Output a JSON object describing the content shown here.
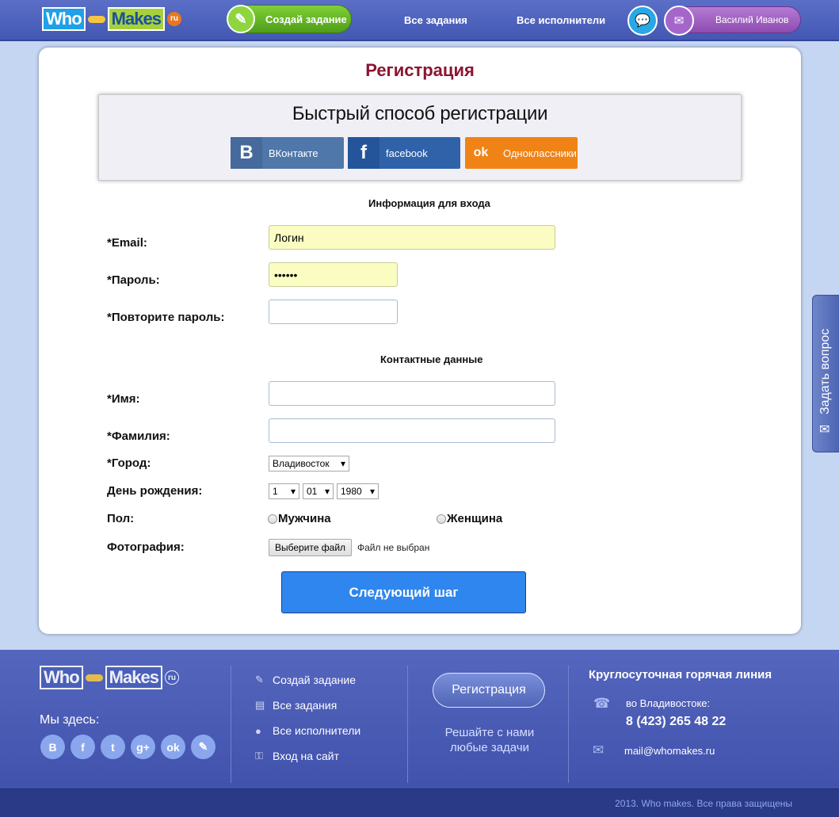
{
  "header": {
    "logo_who": "Who",
    "logo_makes": "Makes",
    "logo_ru": "ru",
    "create_task": "Создай задание",
    "all_tasks": "Все задания",
    "all_performers": "Все исполнители",
    "user_name": "Василий Иванов"
  },
  "page": {
    "title": "Регистрация",
    "quick_title": "Быстрый способ регистрации",
    "social": [
      {
        "label": "ВКонтакте",
        "glyph": "B",
        "color": "#4f77a9",
        "icon": "vk-icon"
      },
      {
        "label": "facebook",
        "glyph": "f",
        "color": "#2f62a8",
        "icon": "facebook-icon"
      },
      {
        "label": "Одноклассники",
        "glyph": "ok",
        "color": "#f08316",
        "icon": "odnoklassniki-icon"
      }
    ],
    "login_section": "Информация для входа",
    "contact_section": "Контактные данные"
  },
  "form": {
    "email_label": "*Email:",
    "email_value": "Логин",
    "password_label": "*Пароль:",
    "password_value": "••••••",
    "password2_label": "*Повторите пароль:",
    "first_name_label": "*Имя:",
    "last_name_label": "*Фамилия:",
    "city_label": "*Город:",
    "city_value": "Владивосток",
    "birthday_label": "День рождения:",
    "birth_day": "1",
    "birth_month": "01",
    "birth_year": "1980",
    "gender_label": "Пол:",
    "gender_male": "Мужчина",
    "gender_female": "Женщина",
    "photo_label": "Фотография:",
    "file_button": "Выберите файл",
    "file_status": "Файл не выбран",
    "next_button": "Следующий шаг"
  },
  "side_tab": {
    "label": "Задать вопрос"
  },
  "footer": {
    "here_label": "Мы здесь:",
    "social_icons": [
      "B",
      "f",
      "t",
      "g+",
      "ok",
      "✎"
    ],
    "links": [
      {
        "label": "Создай задание",
        "icon": "✎"
      },
      {
        "label": "Все задания",
        "icon": "▤"
      },
      {
        "label": "Все исполнители",
        "icon": "●"
      },
      {
        "label": "Вход на сайт",
        "icon": "⚿"
      }
    ],
    "register_button": "Регистрация",
    "slogan": "Решайте с нами любые задачи",
    "hotline_title": "Круглосуточная горячая линия",
    "city_text": "во Владивостоке:",
    "phone": "8 (423) 265 48 22",
    "email": "mail@whomakes.ru",
    "copyright": "2013. Who makes. Все права защищены"
  }
}
